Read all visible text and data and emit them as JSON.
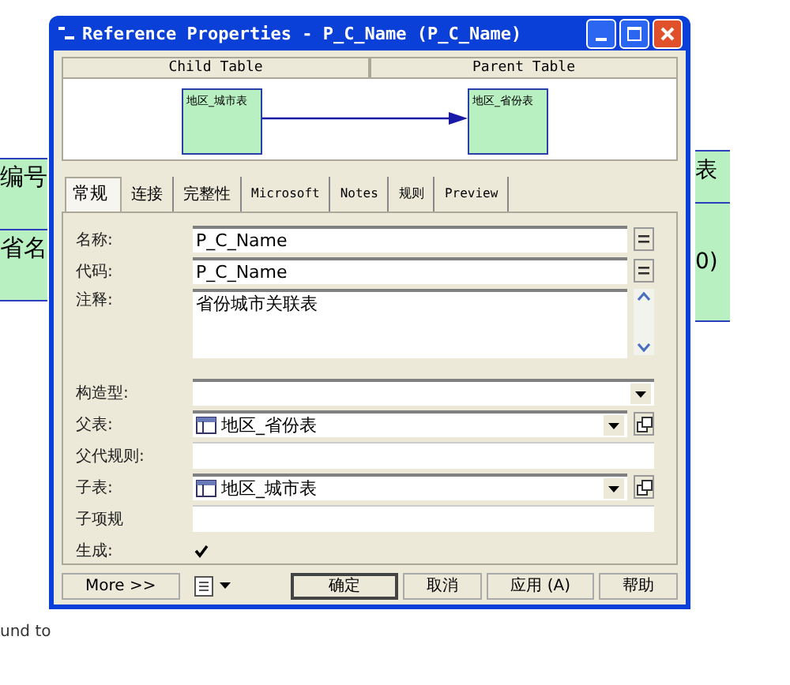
{
  "background": {
    "left_cells": [
      {
        "text": "编号"
      },
      {
        "text": "省名"
      }
    ],
    "right_cells": [
      {
        "text": "表"
      },
      {
        "text": "0)"
      }
    ],
    "status_text": "und to"
  },
  "window": {
    "title": "Reference Properties - P_C_Name (P_C_Name)"
  },
  "diagram": {
    "columns": [
      "Child Table",
      "Parent Table"
    ],
    "child": {
      "label": "地区_城市表"
    },
    "parent": {
      "label": "地区_省份表"
    }
  },
  "tabs": [
    {
      "label": "常规",
      "selected": true
    },
    {
      "label": "连接",
      "selected": false
    },
    {
      "label": "完整性",
      "selected": false
    },
    {
      "label": "Microsoft",
      "selected": false
    },
    {
      "label": "Notes",
      "selected": false
    },
    {
      "label": "规则",
      "selected": false
    },
    {
      "label": "Preview",
      "selected": false
    }
  ],
  "fields": [
    {
      "kind": "text",
      "label": "名称:",
      "value": "P_C_Name"
    },
    {
      "kind": "text",
      "label": "代码:",
      "value": "P_C_Name"
    },
    {
      "kind": "textarea",
      "label": "注释:",
      "value": "省份城市关联表"
    },
    {
      "kind": "combo",
      "label": "构造型:"
    },
    {
      "kind": "table",
      "label": "父表:",
      "value": "地区_省份表"
    },
    {
      "kind": "plain",
      "label": "父代规则:"
    },
    {
      "kind": "table",
      "label": "子表:",
      "value": "地区_城市表"
    },
    {
      "kind": "plain",
      "label": "子项规"
    },
    {
      "kind": "checkbox",
      "label": "生成:",
      "checked": true
    }
  ],
  "buttons": {
    "more": "More >>",
    "ok": "确定",
    "cancel": "取消",
    "apply": "应用 (A)",
    "help": "帮助"
  }
}
